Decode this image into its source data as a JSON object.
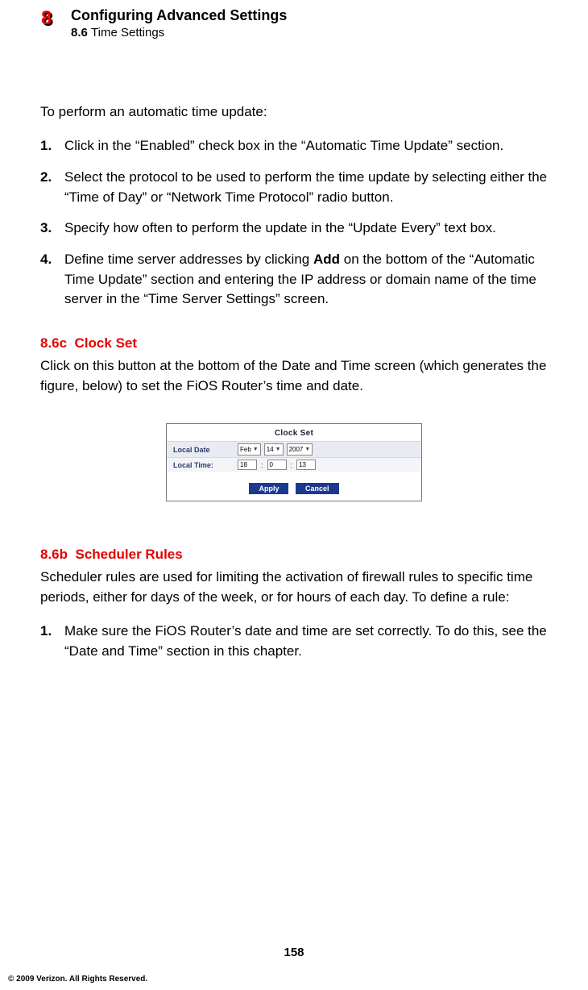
{
  "header": {
    "chapter_number": "8",
    "title": "Configuring Advanced Settings",
    "section_number": "8.6",
    "section_title": "Time Settings"
  },
  "intro": "To perform an automatic time update:",
  "steps_a": [
    {
      "n": "1.",
      "text": "Click in the “Enabled” check box in the “Automatic Time Update” section."
    },
    {
      "n": "2.",
      "text": "Select the protocol to be used to perform the time update by selecting either the “Time of Day” or “Network Time Protocol” radio button."
    },
    {
      "n": "3.",
      "text": "Specify how often to perform the update in the “Update Every” text box."
    },
    {
      "n": "4.",
      "text_pre": "Define time server addresses by clicking ",
      "bold": "Add",
      "text_post": " on the bottom of the “Automatic Time Update” section and entering the IP address or domain name of the time server in the “Time Server Settings” screen."
    }
  ],
  "section_c": {
    "heading_num": "8.6c",
    "heading_txt": "Clock Set",
    "body": "Click on this button at the bottom of the Date and Time screen (which generates the figure, below) to set the FiOS Router’s time and date."
  },
  "figure": {
    "title": "Clock Set",
    "row1_label": "Local Date",
    "date_month": "Feb",
    "date_day": "14",
    "date_year": "2007",
    "row2_label": "Local Time:",
    "time_h": "18",
    "time_m": "0",
    "time_s": "13",
    "btn_apply": "Apply",
    "btn_cancel": "Cancel"
  },
  "section_b": {
    "heading_num": "8.6b",
    "heading_txt": "Scheduler Rules",
    "body": "Scheduler rules are used for limiting the activation of firewall rules to specific time periods, either for days of the week, or for hours of each day.  To define a rule:",
    "steps": [
      {
        "n": "1.",
        "text": "Make sure the FiOS Router’s date and time are set correctly. To do this, see the “Date and Time” section in this chapter."
      }
    ]
  },
  "page_number": "158",
  "copyright": "© 2009 Verizon. All Rights Reserved."
}
